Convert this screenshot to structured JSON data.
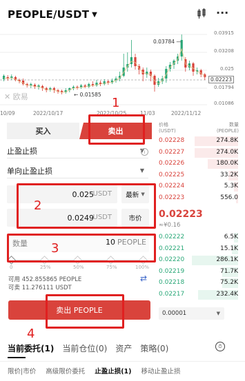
{
  "header": {
    "pair": "PEOPLE/USDT",
    "icons": [
      "chevron-down-icon",
      "candlestick-icon",
      "more-icon"
    ]
  },
  "chart": {
    "y_labels": [
      "0.03915",
      "0.03208",
      "0.025",
      "0.02223",
      "0.01794",
      "0.01086"
    ],
    "x_labels": [
      "10/09",
      "2022/10/17",
      "2022/10/25",
      "11/03",
      "2022/11/12"
    ],
    "high_label": "0.03784",
    "low_label": "0.01585",
    "current_label": "0.02223",
    "watermark": "欧易"
  },
  "order": {
    "tabs": [
      "买入",
      "卖出"
    ],
    "order_type": "止盈止损",
    "sub_type": "单向止盈止损",
    "trigger_price": "0.025",
    "trigger_price_unit": "USDT",
    "trigger_mode": "最新",
    "order_price": "0.0249",
    "order_price_unit": "USDT",
    "market_button": "市价",
    "quantity_label": "数量",
    "quantity_value": "10",
    "quantity_unit": "PEOPLE",
    "slider_labels": [
      "0",
      "25%",
      "50%",
      "75%",
      "100%"
    ],
    "slider_percent": 0,
    "available": "可用  452.855865 PEOPLE",
    "sellable": "可卖  11.276111 USDT",
    "submit": "卖出 PEOPLE"
  },
  "orderbook": {
    "head_price": [
      "价格",
      "(USDT)"
    ],
    "head_size": [
      "数量",
      "(PEOPLE)"
    ],
    "asks": [
      {
        "price": "0.02228",
        "size": "274.8K",
        "depth": 0.55
      },
      {
        "price": "0.02227",
        "size": "274.0K",
        "depth": 0.55
      },
      {
        "price": "0.02226",
        "size": "180.0K",
        "depth": 0.38
      },
      {
        "price": "0.02225",
        "size": "33.2K",
        "depth": 0.12
      },
      {
        "price": "0.02224",
        "size": "5.3K",
        "depth": 0.05
      },
      {
        "price": "0.02223",
        "size": "556.0",
        "depth": 0.03
      }
    ],
    "mid_price": "0.02223",
    "mid_fiat": "≈¥0.16",
    "bids": [
      {
        "price": "0.02222",
        "size": "6.5K",
        "depth": 0.05
      },
      {
        "price": "0.02221",
        "size": "15.1K",
        "depth": 0.08
      },
      {
        "price": "0.02220",
        "size": "286.1K",
        "depth": 0.58
      },
      {
        "price": "0.02219",
        "size": "71.7K",
        "depth": 0.2
      },
      {
        "price": "0.02218",
        "size": "75.2K",
        "depth": 0.2
      },
      {
        "price": "0.02217",
        "size": "232.4K",
        "depth": 0.5
      }
    ],
    "depth_select": "0.00001"
  },
  "bottom": {
    "tabs": [
      "当前委托(1)",
      "当前仓位(0)",
      "资产",
      "策略(0)"
    ],
    "subtabs": [
      "限价|市价",
      "高级限价委托",
      "止盈止损(1)",
      "移动止盈止损"
    ]
  },
  "annotations": [
    "1",
    "2",
    "3",
    "4"
  ],
  "colors": {
    "sell": "#d9433c",
    "buy": "#2aa878",
    "annotation": "#e02020"
  }
}
